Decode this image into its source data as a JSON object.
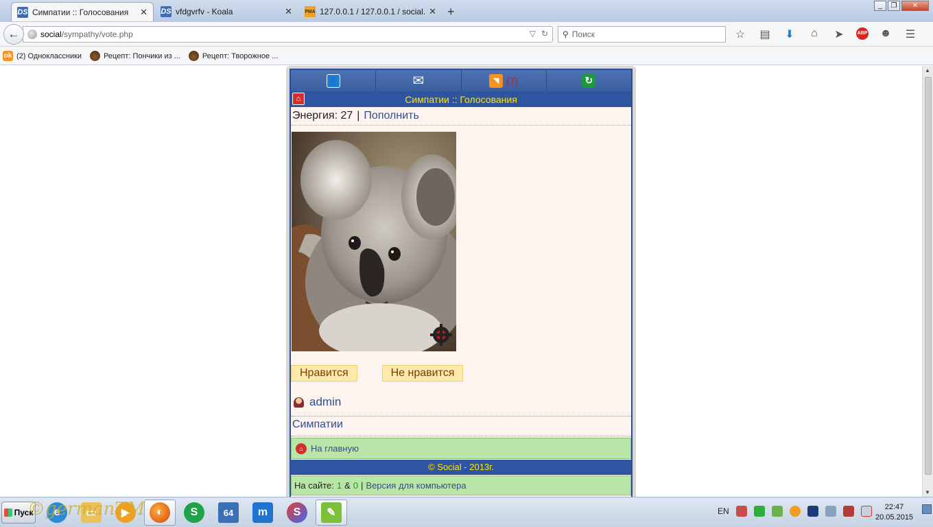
{
  "browser": {
    "tabs": [
      {
        "label": "Симпатии :: Голосования",
        "favicon": "DS",
        "active": true
      },
      {
        "label": "vfdgvrfv - Koala",
        "favicon": "DS",
        "active": false
      },
      {
        "label": "127.0.0.1 / 127.0.0.1 / social...",
        "favicon": "PMA",
        "active": false
      }
    ],
    "new_tab_symbol": "+",
    "window_buttons": [
      "_",
      "❐",
      "✕"
    ],
    "url_host": "social",
    "url_path": "/sympathy/vote.php",
    "search_placeholder": "Поиск",
    "bookmarks": [
      {
        "label": "(2) Одноклассники",
        "icon": "ok-icon"
      },
      {
        "label": "Рецепт: Пончики из ...",
        "icon": "pot-icon"
      },
      {
        "label": "Рецепт: Творожное ...",
        "icon": "pot-icon"
      }
    ]
  },
  "site": {
    "nav": {
      "rss_count": "(7)"
    },
    "title": "Симпатии :: Голосования",
    "energy_label": "Энергия: 27",
    "energy_sep": "|",
    "energy_link": "Пополнить",
    "like_label": "Нравится",
    "dislike_label": "Не нравится",
    "username": "admin",
    "sympathy_link": "Симпатии",
    "home_link": "На главную",
    "footer": "© Social - 2013г.",
    "online_label": "На сайте:",
    "online_users": "1",
    "online_amp": "&",
    "online_guests": "0",
    "online_sep": "|",
    "desktop_version": "Версия для компьютера"
  },
  "taskbar": {
    "start_label": "Пуск",
    "watermark": "©germanTM",
    "lang": "EN",
    "time": "22:47",
    "date": "20.05.2015"
  },
  "colors": {
    "site_blue": "#3055a0",
    "title_yellow": "#ffe600",
    "green_bar": "#b9e6a8",
    "vote_button": "#fdeaa9"
  }
}
